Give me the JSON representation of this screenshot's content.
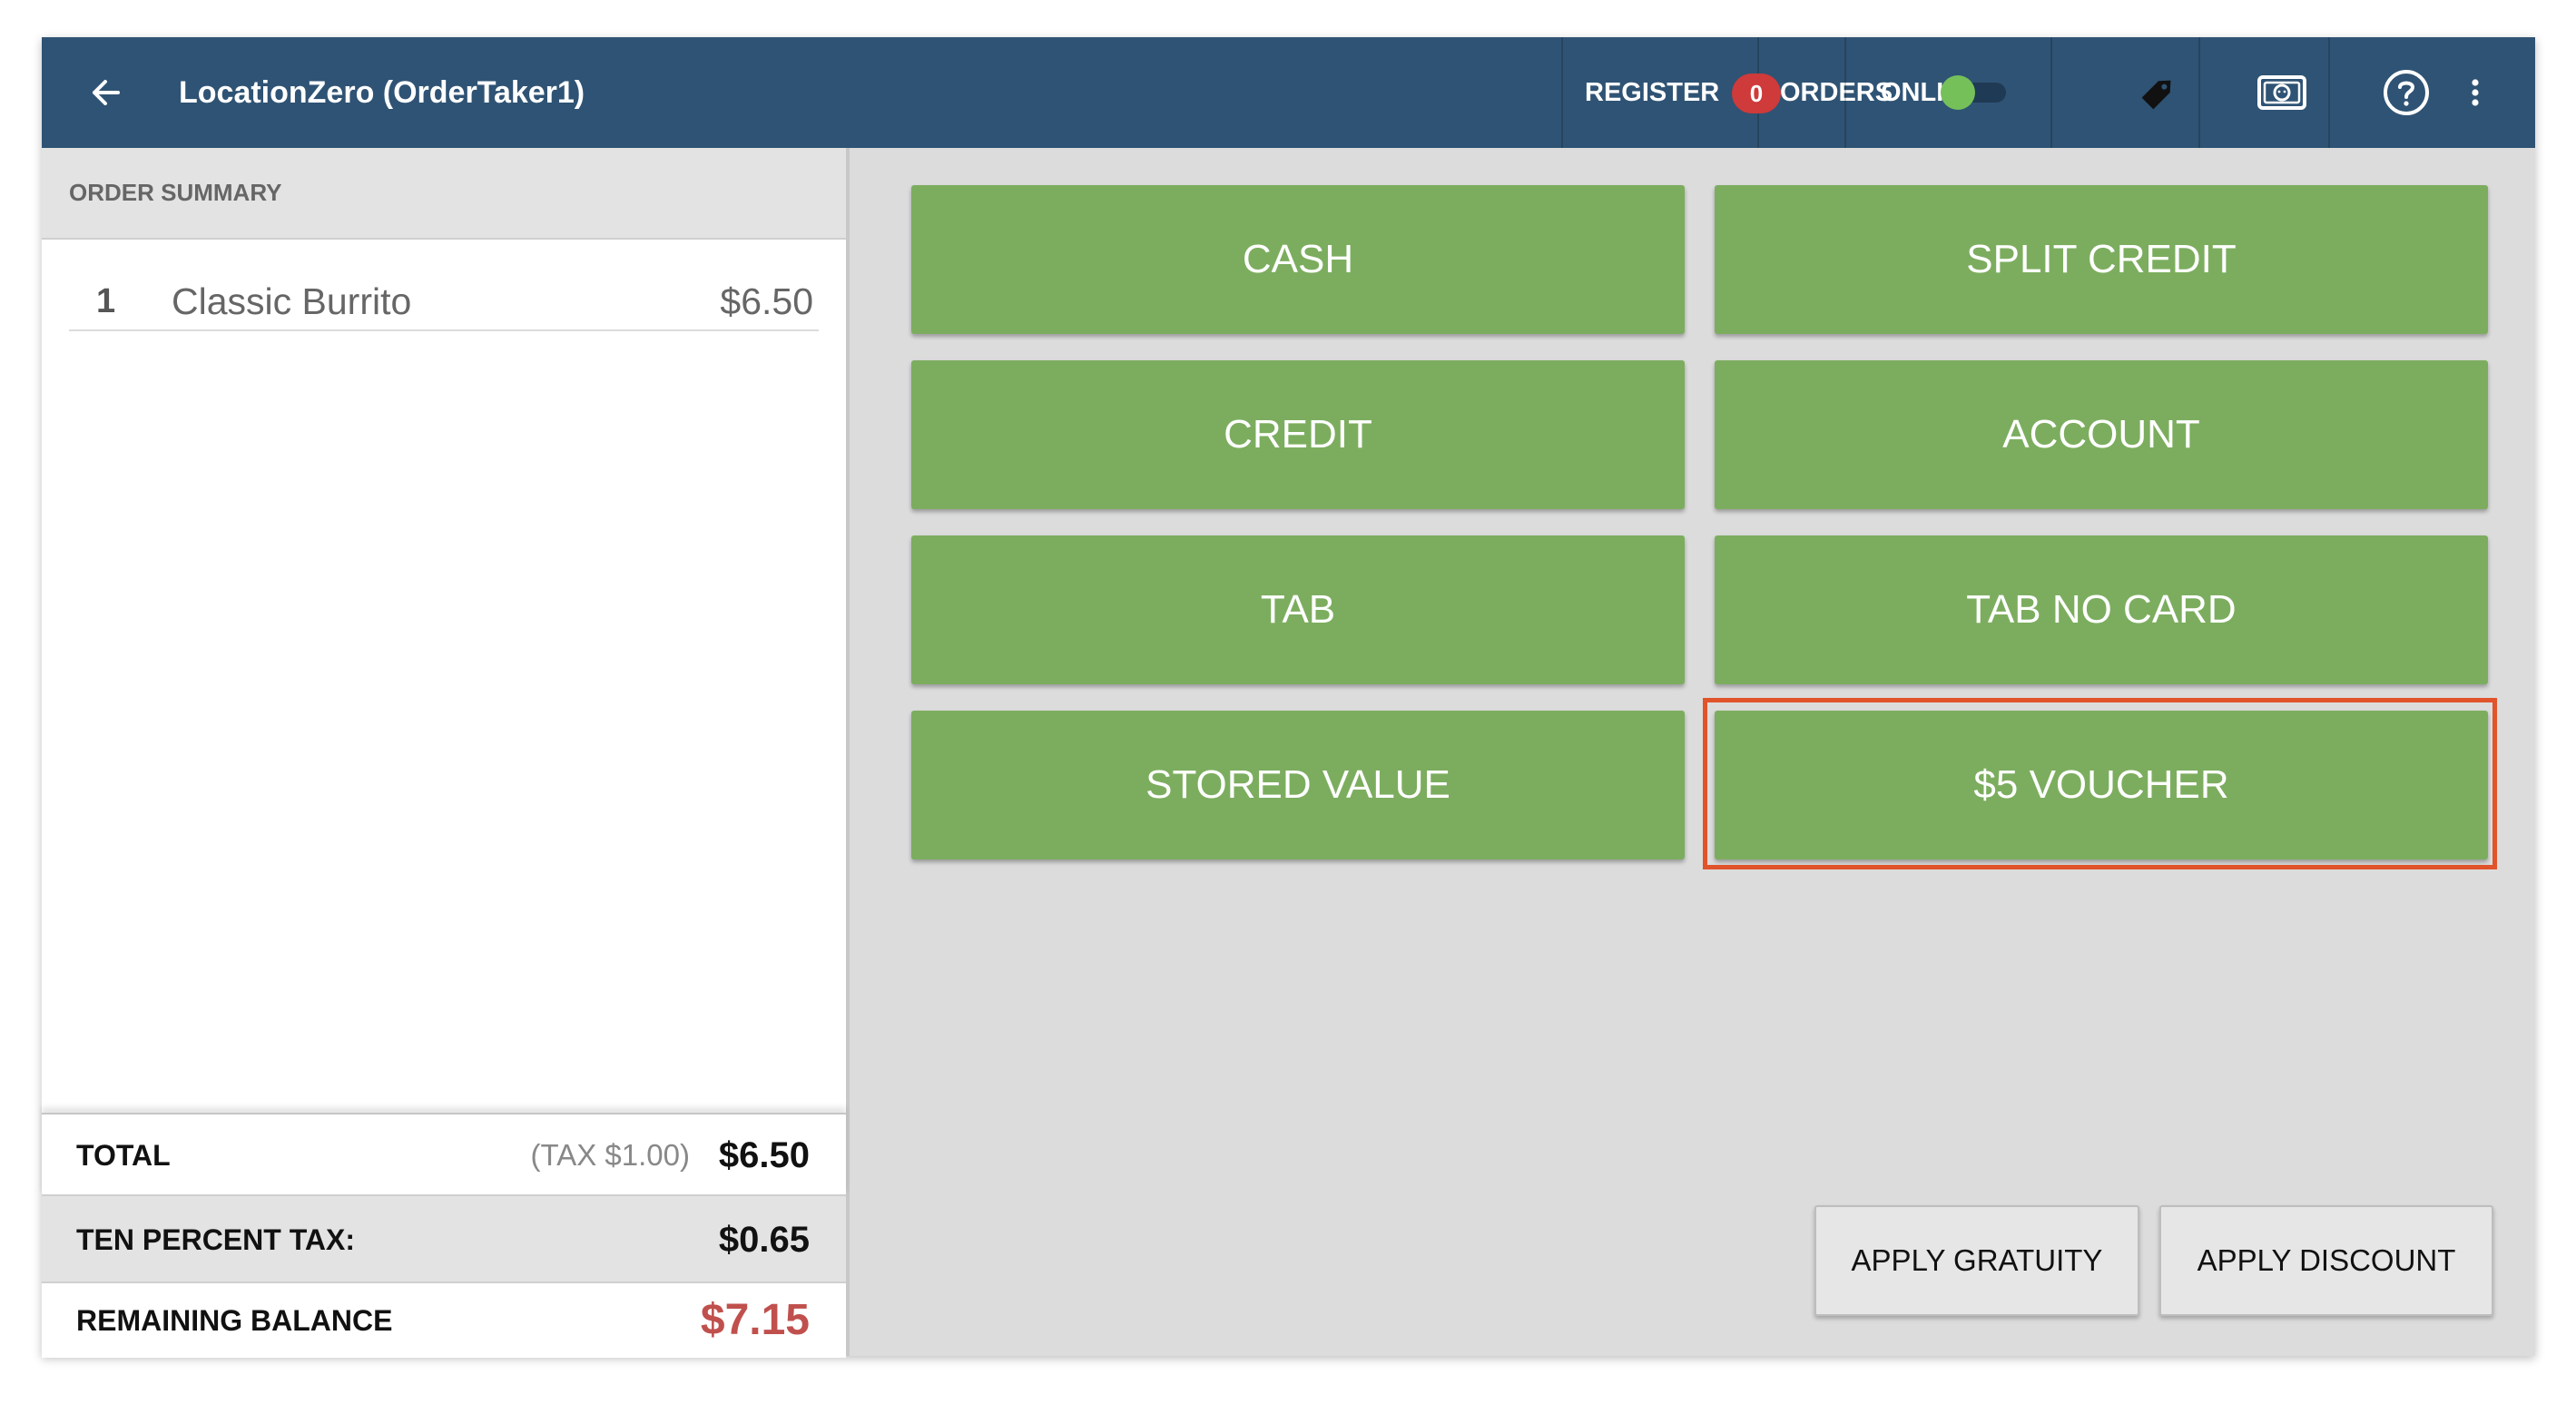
{
  "header": {
    "title": "LocationZero (OrderTaker1)",
    "back_icon": "arrow-left-icon",
    "register_label": "REGISTER",
    "orders_label": "ORDERS",
    "orders_count": "0",
    "online_label": "ONLINE",
    "online_on": true,
    "icons": [
      "tag-icon",
      "cash-drawer-icon",
      "help-icon",
      "more-vertical-icon"
    ]
  },
  "order_summary": {
    "title": "ORDER SUMMARY",
    "items": [
      {
        "qty": "1",
        "name": "Classic Burrito",
        "price": "$6.50"
      }
    ],
    "total_label": "TOTAL",
    "total_tax_note": "(TAX $1.00)",
    "total_value": "$6.50",
    "tax_label": "TEN PERCENT TAX:",
    "tax_value": "$0.65",
    "balance_label": "REMAINING BALANCE",
    "balance_value": "$7.15"
  },
  "payment_methods": [
    "CASH",
    "SPLIT CREDIT",
    "CREDIT",
    "ACCOUNT",
    "TAB",
    "TAB NO CARD",
    "STORED VALUE",
    "$5 VOUCHER"
  ],
  "actions": {
    "gratuity": "APPLY GRATUITY",
    "discount": "APPLY DISCOUNT"
  },
  "colors": {
    "header_bg": "#2f5374",
    "button_green": "#7cad5f",
    "badge_red": "#cf3a3a",
    "balance_red": "#c0504d",
    "highlight": "#e0532b"
  }
}
